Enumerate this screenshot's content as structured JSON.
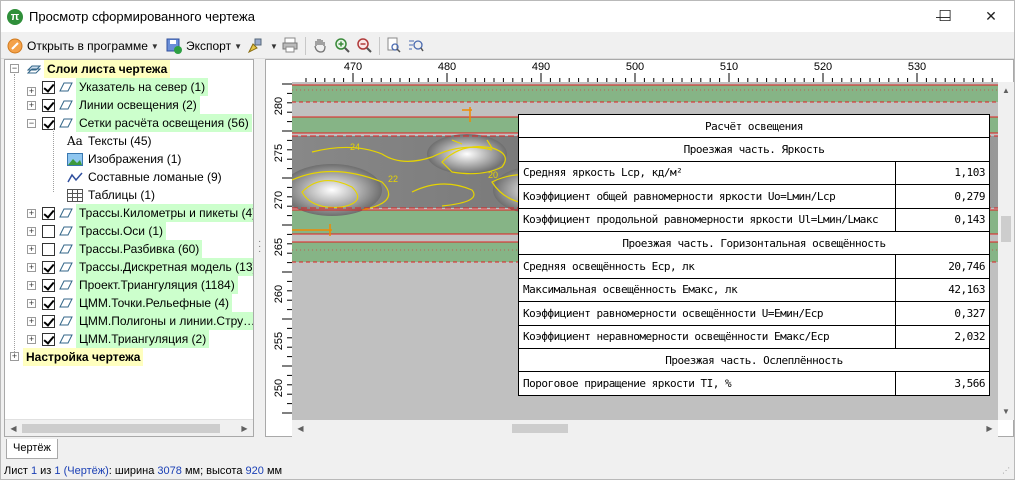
{
  "window": {
    "title": "Просмотр сформированного чертежа",
    "minimize": "—",
    "maximize": "☐",
    "close": "✕"
  },
  "toolbar": {
    "open_in_program": "Открыть в программе",
    "export": "Экспорт"
  },
  "tree": {
    "root_layers": "Слои листа чертежа",
    "items": [
      {
        "label": "Указатель на север (1)",
        "checked": true
      },
      {
        "label": "Линии освещения (2)",
        "checked": true
      },
      {
        "label": "Сетки расчёта освещения (56)",
        "checked": true
      }
    ],
    "sub_items": [
      {
        "label": "Тексты (45)",
        "icon": "text-icon"
      },
      {
        "label": "Изображения (1)",
        "icon": "image-icon"
      },
      {
        "label": "Составные ломаные (9)",
        "icon": "polyline-icon"
      },
      {
        "label": "Таблицы (1)",
        "icon": "table-icon"
      }
    ],
    "items2": [
      {
        "label": "Трассы.Километры и пикеты (4)",
        "checked": true
      },
      {
        "label": "Трассы.Оси (1)",
        "checked": false
      },
      {
        "label": "Трассы.Разбивка (60)",
        "checked": false
      },
      {
        "label": "Трассы.Дискретная модель (13)",
        "checked": true
      },
      {
        "label": "Проект.Триангуляция (1184)",
        "checked": true
      },
      {
        "label": "ЦММ.Точки.Рельефные (4)",
        "checked": true
      },
      {
        "label": "ЦММ.Полигоны и линии.Стру…",
        "checked": true
      },
      {
        "label": "ЦММ.Триангуляция (2)",
        "checked": true
      }
    ],
    "root_settings": "Настройка чертежа"
  },
  "rulers": {
    "top": [
      "470",
      "480",
      "490",
      "500",
      "510",
      "520",
      "530"
    ],
    "left": [
      "280",
      "275",
      "270",
      "265",
      "260",
      "255",
      "250"
    ]
  },
  "contour_labels": [
    "24",
    "22",
    "20"
  ],
  "calc_table": {
    "title": "Расчёт освещения",
    "sec1": "Проезжая часть. Яркость",
    "r1": {
      "label": "Средняя яркость Lср, кд/м²",
      "value": "1,103"
    },
    "r2": {
      "label": "Коэффициент общей равномерности яркости Uo=Lмин/Lср",
      "value": "0,279"
    },
    "r3": {
      "label": "Коэффициент продольной равномерности яркости Ul=Lмин/Lмакс",
      "value": "0,143"
    },
    "sec2": "Проезжая часть. Горизонтальная освещённость",
    "r4": {
      "label": "Средняя освещённость Eср, лк",
      "value": "20,746"
    },
    "r5": {
      "label": "Максимальная освещённость Eмакс, лк",
      "value": "42,163"
    },
    "r6": {
      "label": "Коэффициент равномерности освещённости U=Eмин/Eср",
      "value": "0,327"
    },
    "r7": {
      "label": "Коэффициент неравномерности освещённости Eмакс/Eср",
      "value": "2,032"
    },
    "sec3": "Проезжая часть. Ослеплённость",
    "r8": {
      "label": "Пороговое приращение яркости TI, %",
      "value": "3,566"
    }
  },
  "tabs": {
    "drawing": "Чертёж"
  },
  "status": {
    "sheet": "Лист",
    "sheet_num": "1",
    "of": "из",
    "sheet_total": "1",
    "sheet_name": "(Чертёж)",
    "width_label": ": ширина",
    "width": "3078",
    "mm1": "мм; высота",
    "height": "920",
    "mm2": "мм"
  }
}
